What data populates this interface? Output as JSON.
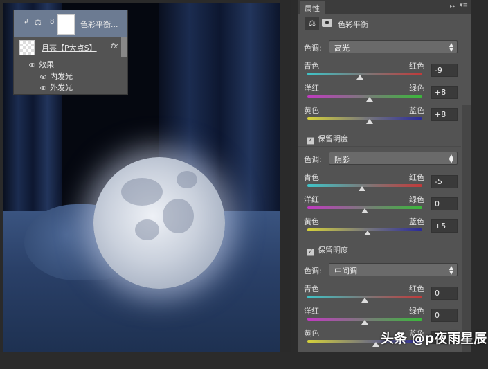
{
  "layers": {
    "adjustment_layer_name": "色彩平衡...",
    "moon_layer_name": "月亮【P大点S】",
    "fx_label": "fx",
    "effects_label": "效果",
    "effects": [
      "内发光",
      "外发光"
    ]
  },
  "properties": {
    "tab_label": "属性",
    "title": "色彩平衡",
    "tone_label": "色调:",
    "preserve_luminosity_label": "保留明度",
    "sections": [
      {
        "tone": "高光",
        "preserve": true,
        "sliders": [
          {
            "left": "青色",
            "right": "红色",
            "value": -9,
            "display": "-9"
          },
          {
            "left": "洋红",
            "right": "绿色",
            "value": 8,
            "display": "+8"
          },
          {
            "left": "黄色",
            "right": "蓝色",
            "value": 8,
            "display": "+8"
          }
        ]
      },
      {
        "tone": "阴影",
        "preserve": true,
        "sliders": [
          {
            "left": "青色",
            "right": "红色",
            "value": -5,
            "display": "-5"
          },
          {
            "left": "洋红",
            "right": "绿色",
            "value": 0,
            "display": "0"
          },
          {
            "left": "黄色",
            "right": "蓝色",
            "value": 5,
            "display": "+5"
          }
        ]
      },
      {
        "tone": "中间调",
        "preserve": null,
        "sliders": [
          {
            "left": "青色",
            "right": "红色",
            "value": 0,
            "display": "0"
          },
          {
            "left": "洋红",
            "right": "绿色",
            "value": 0,
            "display": "0"
          },
          {
            "left": "黄色",
            "right": "蓝色",
            "value": 19,
            "display": ""
          }
        ]
      }
    ]
  },
  "track_colors": {
    "cyan_red": [
      "#3fc4c8",
      "#c23a3a"
    ],
    "magenta_green": [
      "#c23ac2",
      "#3ab83a"
    ],
    "yellow_blue": [
      "#d6d23a",
      "#2a2a9a"
    ]
  },
  "watermark": "头条 @p夜雨星辰"
}
